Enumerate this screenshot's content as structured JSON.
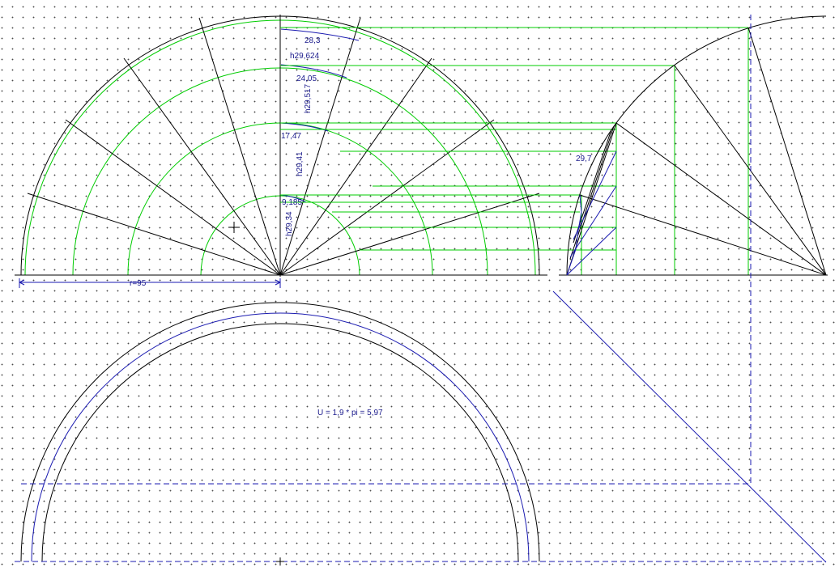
{
  "drawing": {
    "labels": {
      "step_top": "28,3",
      "height_1": "h29,624",
      "step_2": "24,05",
      "height_2": "h29,517",
      "step_3": "17,47",
      "height_3": "h29,41",
      "step_4": "9,185",
      "height_4": "h29,34",
      "side_step": "29,7",
      "radius_dim": "r=95",
      "circumference": "U = 1,9 * pi = 5,97"
    },
    "colors": {
      "construction_line": "#000000",
      "step_lines": "#00cc00",
      "blue_lines": "#1a1ab0",
      "grid_dots": "#4a4a4a",
      "background": "#ffffff"
    }
  }
}
